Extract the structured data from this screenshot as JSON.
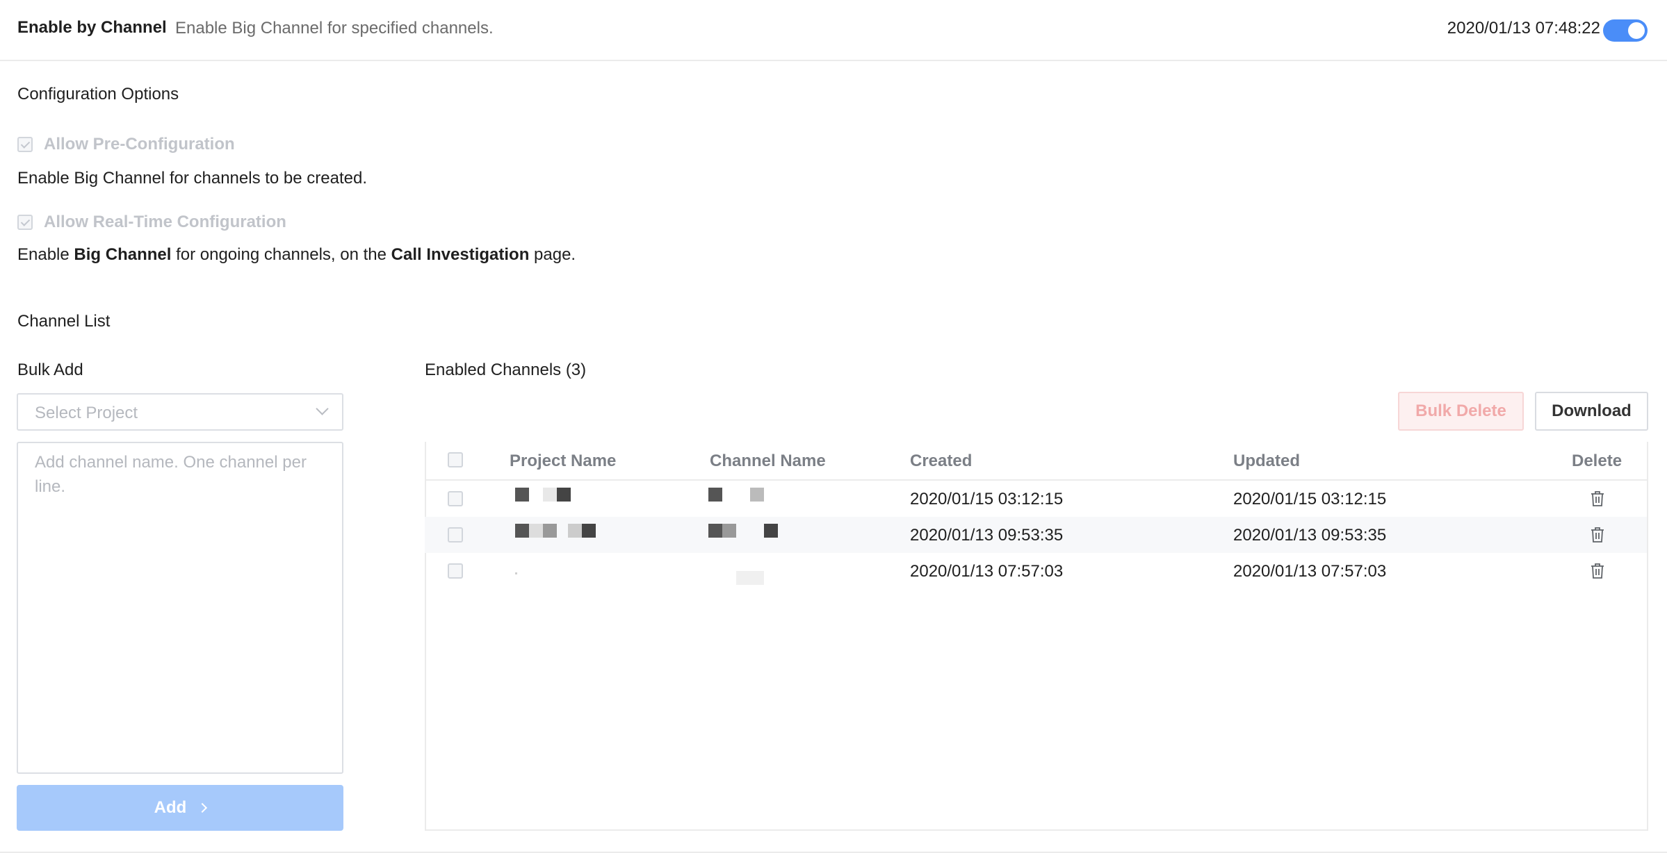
{
  "header": {
    "title": "Enable by Channel",
    "description": "Enable Big Channel for specified channels.",
    "timestamp": "2020/01/13 07:48:22",
    "toggle_on": true
  },
  "config": {
    "section_title": "Configuration Options",
    "pre_config_label": "Allow Pre-Configuration",
    "pre_config_desc": "Enable Big Channel for channels to be created.",
    "realtime_label": "Allow Real-Time Configuration",
    "realtime_desc_prefix": "Enable ",
    "realtime_desc_bold1": "Big Channel",
    "realtime_desc_middle": " for ongoing channels, on the ",
    "realtime_desc_bold2": "Call Investigation",
    "realtime_desc_suffix": " page."
  },
  "channel_list": {
    "section_title": "Channel List",
    "bulk_add": {
      "title": "Bulk Add",
      "select_placeholder": "Select Project",
      "textarea_placeholder": "Add channel name. One channel per line.",
      "add_label": "Add"
    },
    "enabled": {
      "title": "Enabled Channels (3)",
      "bulk_delete_label": "Bulk Delete",
      "download_label": "Download",
      "columns": [
        "Project Name",
        "Channel Name",
        "Created",
        "Updated",
        "Delete"
      ],
      "rows": [
        {
          "created": "2020/01/15 03:12:15",
          "updated": "2020/01/15 03:12:15"
        },
        {
          "created": "2020/01/13 09:53:35",
          "updated": "2020/01/13 09:53:35"
        },
        {
          "created": "2020/01/13 07:57:03",
          "updated": "2020/01/13 07:57:03"
        }
      ]
    }
  },
  "colors": {
    "accent": "#4a8df8",
    "add_button": "#a6c9fb",
    "bulk_delete_text": "#f1a9a9"
  }
}
